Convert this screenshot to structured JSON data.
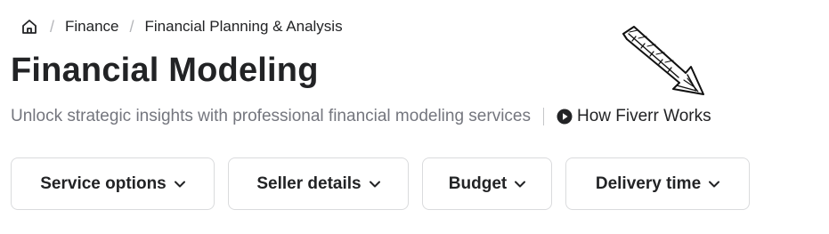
{
  "breadcrumb": {
    "home_icon": "home-icon",
    "items": [
      "Finance",
      "Financial Planning & Analysis"
    ]
  },
  "page": {
    "title": "Financial Modeling",
    "subtitle": "Unlock strategic insights with professional financial modeling services",
    "how_link": {
      "icon": "play-circle-icon",
      "label": "How Fiverr Works"
    }
  },
  "annotation": {
    "icon": "hand-drawn-arrow-icon"
  },
  "filters": [
    {
      "label": "Service options",
      "icon": "chevron-down-icon"
    },
    {
      "label": "Seller details",
      "icon": "chevron-down-icon"
    },
    {
      "label": "Budget",
      "icon": "chevron-down-icon"
    },
    {
      "label": "Delivery time",
      "icon": "chevron-down-icon"
    }
  ],
  "colors": {
    "text": "#222325",
    "muted": "#74767e",
    "border": "#dadbdd",
    "separator": "#b5b6ba"
  }
}
